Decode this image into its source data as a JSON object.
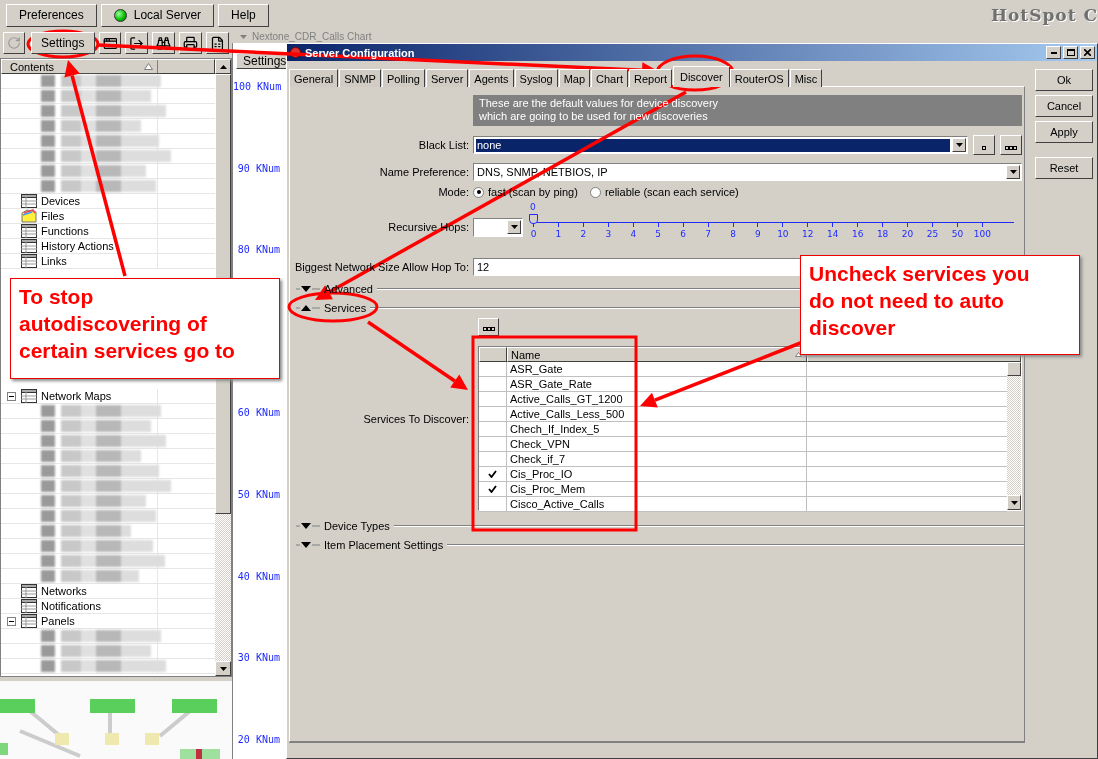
{
  "top_bar": {
    "buttons": [
      {
        "label": "Preferences",
        "kind": "plain"
      },
      {
        "label": "Local Server",
        "kind": "status"
      },
      {
        "label": "Help",
        "kind": "plain"
      }
    ],
    "brand": "HotSpot C"
  },
  "toolbar": {
    "settings": "Settings"
  },
  "tree": {
    "column": "Contents",
    "items": [
      {
        "kind": "blurred"
      },
      {
        "kind": "blurred"
      },
      {
        "kind": "blurred"
      },
      {
        "kind": "blurred"
      },
      {
        "kind": "blurred"
      },
      {
        "kind": "blurred"
      },
      {
        "kind": "blurred"
      },
      {
        "kind": "blurred"
      },
      {
        "kind": "table",
        "label": "Devices"
      },
      {
        "kind": "folder",
        "label": "Files"
      },
      {
        "kind": "table",
        "label": "Functions"
      },
      {
        "kind": "table",
        "label": "History Actions"
      },
      {
        "kind": "table",
        "label": "Links"
      }
    ],
    "lower_items": [
      {
        "kind": "table",
        "label": "Network Maps",
        "expanded": true,
        "children": [
          {
            "kind": "blurred"
          },
          {
            "kind": "blurred"
          },
          {
            "kind": "blurred"
          },
          {
            "kind": "blurred"
          },
          {
            "kind": "blurred"
          },
          {
            "kind": "blurred"
          },
          {
            "kind": "blurred"
          },
          {
            "kind": "blurred"
          },
          {
            "kind": "blurred"
          },
          {
            "kind": "blurred"
          },
          {
            "kind": "blurred"
          },
          {
            "kind": "blurred"
          }
        ]
      },
      {
        "kind": "table",
        "label": "Networks"
      },
      {
        "kind": "table",
        "label": "Notifications"
      },
      {
        "kind": "table",
        "label": "Panels",
        "expanded": true,
        "children": [
          {
            "kind": "blurred"
          },
          {
            "kind": "blurred"
          },
          {
            "kind": "blurred"
          }
        ]
      }
    ]
  },
  "chart_window": {
    "title": "Nextone_CDR_Calls Chart",
    "settings": "Settings",
    "axis_labels_upper": [
      "100 KNum",
      "90 KNum",
      "80 KNum"
    ],
    "axis_labels_lower": [
      "60 KNum",
      "50 KNum",
      "40 KNum",
      "30 KNum",
      "20 KNum"
    ]
  },
  "dialog": {
    "title": "Server Configuration",
    "tabs": [
      {
        "label": "General",
        "selected": false
      },
      {
        "label": "SNMP",
        "selected": false
      },
      {
        "label": "Polling",
        "selected": false
      },
      {
        "label": "Server",
        "selected": false
      },
      {
        "label": "Agents",
        "selected": false
      },
      {
        "label": "Syslog",
        "selected": false
      },
      {
        "label": "Map",
        "selected": false
      },
      {
        "label": "Chart",
        "selected": false
      },
      {
        "label": "Report",
        "selected": false
      },
      {
        "label": "Discover",
        "selected": true
      },
      {
        "label": "RouterOS",
        "selected": false
      },
      {
        "label": "Misc",
        "selected": false
      }
    ],
    "info": [
      "These are the default values for device discovery",
      "which are going to be used for new discoveries"
    ],
    "black_list": {
      "label": "Black List:",
      "value": "none"
    },
    "name_preference": {
      "label": "Name Preference:",
      "value": "DNS, SNMP, NETBIOS, IP"
    },
    "mode": {
      "label": "Mode:",
      "options": [
        {
          "label": "fast (scan by ping)",
          "selected": true
        },
        {
          "label": "reliable (scan each service)",
          "selected": false
        }
      ]
    },
    "recursive_hops": {
      "label": "Recursive Hops:",
      "value_label": "0",
      "level": 0,
      "ticks": [
        "0",
        "1",
        "2",
        "3",
        "4",
        "5",
        "6",
        "7",
        "8",
        "9",
        "10",
        "12",
        "14",
        "16",
        "18",
        "20",
        "25",
        "50",
        "100"
      ]
    },
    "biggest_network": {
      "label": "Biggest Network Size Allow Hop To:",
      "value": "12"
    },
    "sections": [
      {
        "label": "Advanced",
        "expanded": false,
        "kind": "plain"
      },
      {
        "label": "Services",
        "expanded": true,
        "kind": "services"
      },
      {
        "label": "Device Types",
        "expanded": false,
        "kind": "plain"
      },
      {
        "label": "Item Placement Settings",
        "expanded": false,
        "kind": "plain"
      }
    ],
    "services": {
      "label": "Services To Discover:",
      "column": "Name",
      "rows": [
        {
          "name": "ASR_Gate",
          "checked": false
        },
        {
          "name": "ASR_Gate_Rate",
          "checked": false
        },
        {
          "name": "Active_Calls_GT_1200",
          "checked": false
        },
        {
          "name": "Active_Calls_Less_500",
          "checked": false
        },
        {
          "name": "Chech_If_Index_5",
          "checked": false
        },
        {
          "name": "Check_VPN",
          "checked": false
        },
        {
          "name": "Check_if_7",
          "checked": false
        },
        {
          "name": "Cis_Proc_IO",
          "checked": true
        },
        {
          "name": "Cis_Proc_Mem",
          "checked": true
        },
        {
          "name": "Cisco_Active_Calls",
          "checked": false
        }
      ]
    },
    "buttons": [
      "Ok",
      "Cancel",
      "Apply",
      "Reset"
    ]
  },
  "annotations": [
    {
      "text": "To stop autodiscovering of certain services go to"
    },
    {
      "text": "Uncheck services you do not need to auto discover"
    }
  ]
}
